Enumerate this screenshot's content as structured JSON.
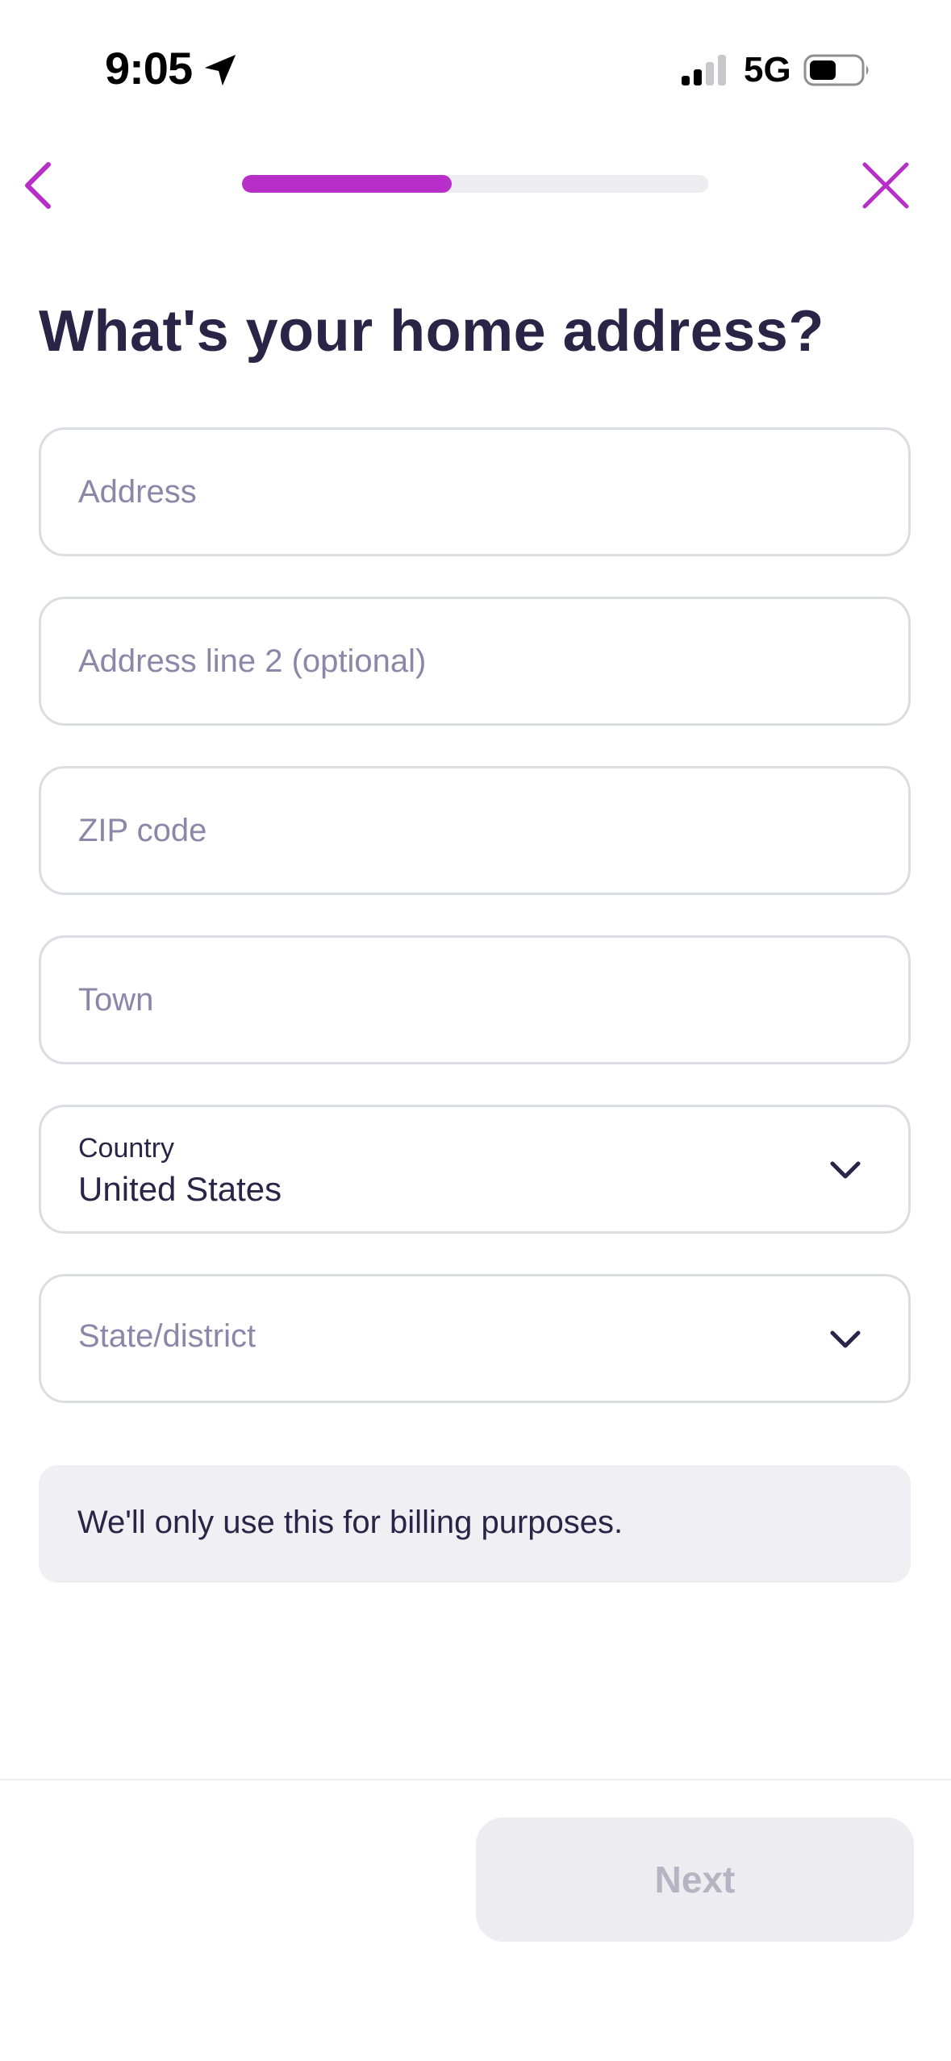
{
  "status_bar": {
    "time": "9:05",
    "network": "5G",
    "icons": [
      "location-arrow-icon",
      "signal-icon",
      "battery-icon"
    ]
  },
  "nav": {
    "back_icon": "chevron-left-icon",
    "close_icon": "close-icon",
    "progress_fraction": 0.45
  },
  "page": {
    "title": "What's your home address?"
  },
  "form": {
    "address": {
      "placeholder": "Address",
      "value": ""
    },
    "address_line2": {
      "placeholder": "Address line 2 (optional)",
      "value": ""
    },
    "zip": {
      "placeholder": "ZIP code",
      "value": ""
    },
    "town": {
      "placeholder": "Town",
      "value": ""
    },
    "country": {
      "label": "Country",
      "value": "United States"
    },
    "state": {
      "placeholder": "State/district"
    }
  },
  "note": {
    "text": "We'll only use this for billing purposes."
  },
  "footer": {
    "next_label": "Next"
  },
  "colors": {
    "accent": "#b72fc8",
    "title": "#2a2447",
    "placeholder": "#8c87a8",
    "border": "#dcdce3",
    "disabled_button_bg": "#ededf1",
    "disabled_button_text": "#b6b4c2"
  }
}
